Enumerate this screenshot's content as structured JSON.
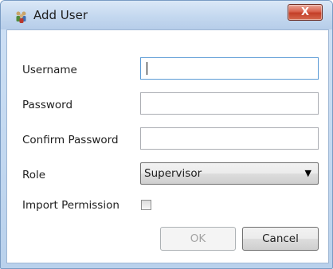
{
  "window": {
    "title": "Add User",
    "title_icon": "users-group-icon",
    "close_label": "X"
  },
  "form": {
    "username": {
      "label": "Username",
      "value": ""
    },
    "password": {
      "label": "Password",
      "value": ""
    },
    "confirm_password": {
      "label": "Confirm Password",
      "value": ""
    },
    "role": {
      "label": "Role",
      "value": "Supervisor"
    },
    "import_permission": {
      "label": "Import Permission",
      "checked": false
    }
  },
  "buttons": {
    "ok_label": "OK",
    "cancel_label": "Cancel"
  },
  "colors": {
    "titlebar": "#c4d8ef",
    "close_button": "#c33e27",
    "focus_border": "#5b9bd5"
  }
}
